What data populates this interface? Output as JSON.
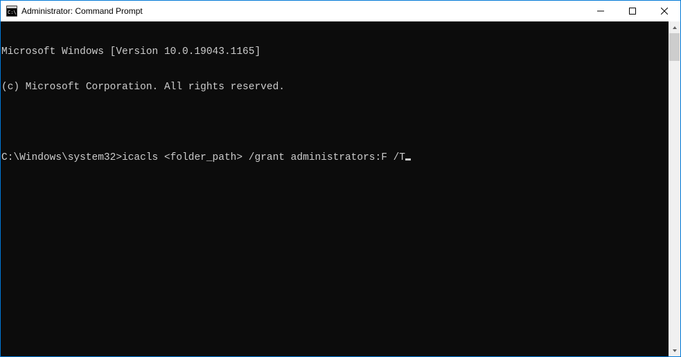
{
  "titlebar": {
    "title": "Administrator: Command Prompt"
  },
  "terminal": {
    "lines": [
      "Microsoft Windows [Version 10.0.19043.1165]",
      "(c) Microsoft Corporation. All rights reserved.",
      "",
      "C:\\Windows\\system32>icacls <folder_path> /grant administrators:F /T"
    ]
  }
}
